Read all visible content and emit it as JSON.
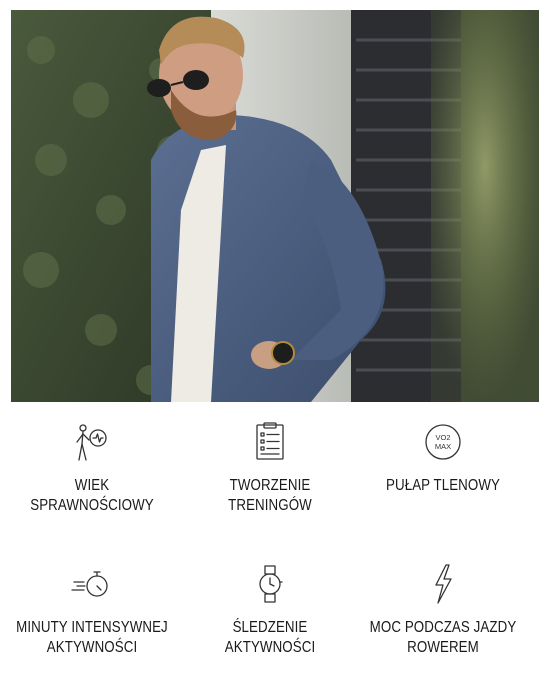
{
  "hero": {
    "image": "man-in-blue-bomber-jacket-wearing-smartwatch"
  },
  "features": [
    {
      "icon": "fitness-age-icon",
      "label": "WIEK SPRAWNOŚCIOWY"
    },
    {
      "icon": "workout-plan-icon",
      "label": "TWORZENIE\nTRENINGÓW"
    },
    {
      "icon": "vo2-max-icon",
      "label": "PUŁAP TLENOWY",
      "icon_text_top": "VO2",
      "icon_text_bottom": "MAX"
    },
    {
      "icon": "stopwatch-icon",
      "label": "MINUTY INTENSYWNEJ\nAKTYWNOŚCI"
    },
    {
      "icon": "watch-icon",
      "label": "ŚLEDZENIE\nAKTYWNOŚCI"
    },
    {
      "icon": "lightning-bolt-icon",
      "label": "MOC PODCZAS JAZDY\nROWEREM"
    }
  ],
  "colors": {
    "text": "#1a1a1a",
    "icon_stroke": "#333333"
  }
}
